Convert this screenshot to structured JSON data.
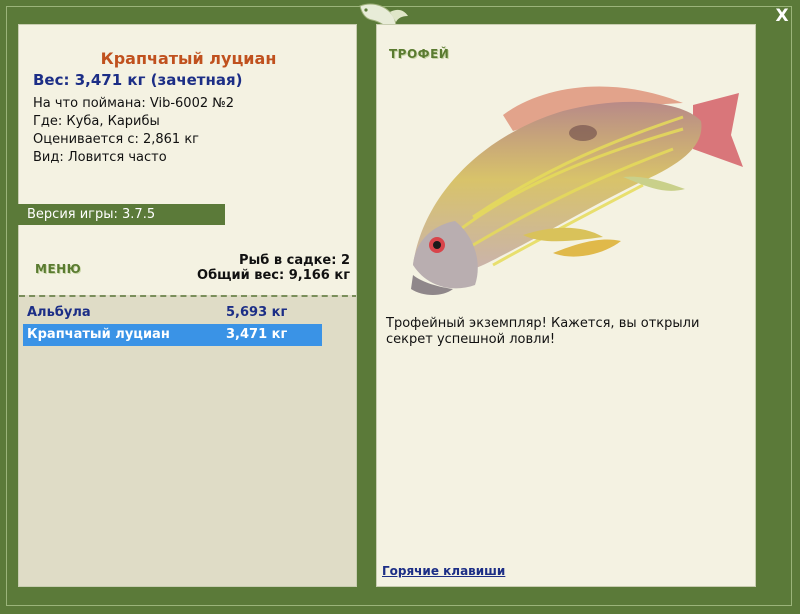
{
  "colors": {
    "frame": "#5b7a39",
    "panel": "#f4f2e2",
    "title": "#c0511e",
    "weight": "#1c2e86",
    "selected_row": "#3a93e6"
  },
  "window": {
    "close_label": "X",
    "logo_icon": "fish-logo-icon"
  },
  "fish_info": {
    "title": "Крапчатый луциан",
    "weight_line": "Вес: 3,471 кг (зачетная)",
    "caught_with": "На что поймана: Vib-6002 №2",
    "location": "Где: Куба, Карибы",
    "rated_from": "Оценивается с: 2,861 кг",
    "kind": "Вид: Ловится часто"
  },
  "version": "Версия игры: 3.7.5",
  "menu_label": "МЕНЮ",
  "cage": {
    "fish_count": "Рыб в садке: 2",
    "total_weight": "Общий вес: 9,166 кг"
  },
  "catch_list": [
    {
      "name": "Альбула",
      "weight": "5,693 кг"
    },
    {
      "name": "Крапчатый луциан",
      "weight": "3,471 кг"
    }
  ],
  "trophy_label": "ТРОФЕЙ",
  "description": "Трофейный экземпляр! Кажется, вы открыли секрет успешной ловли!",
  "hotkeys_link": "Горячие клавиши"
}
